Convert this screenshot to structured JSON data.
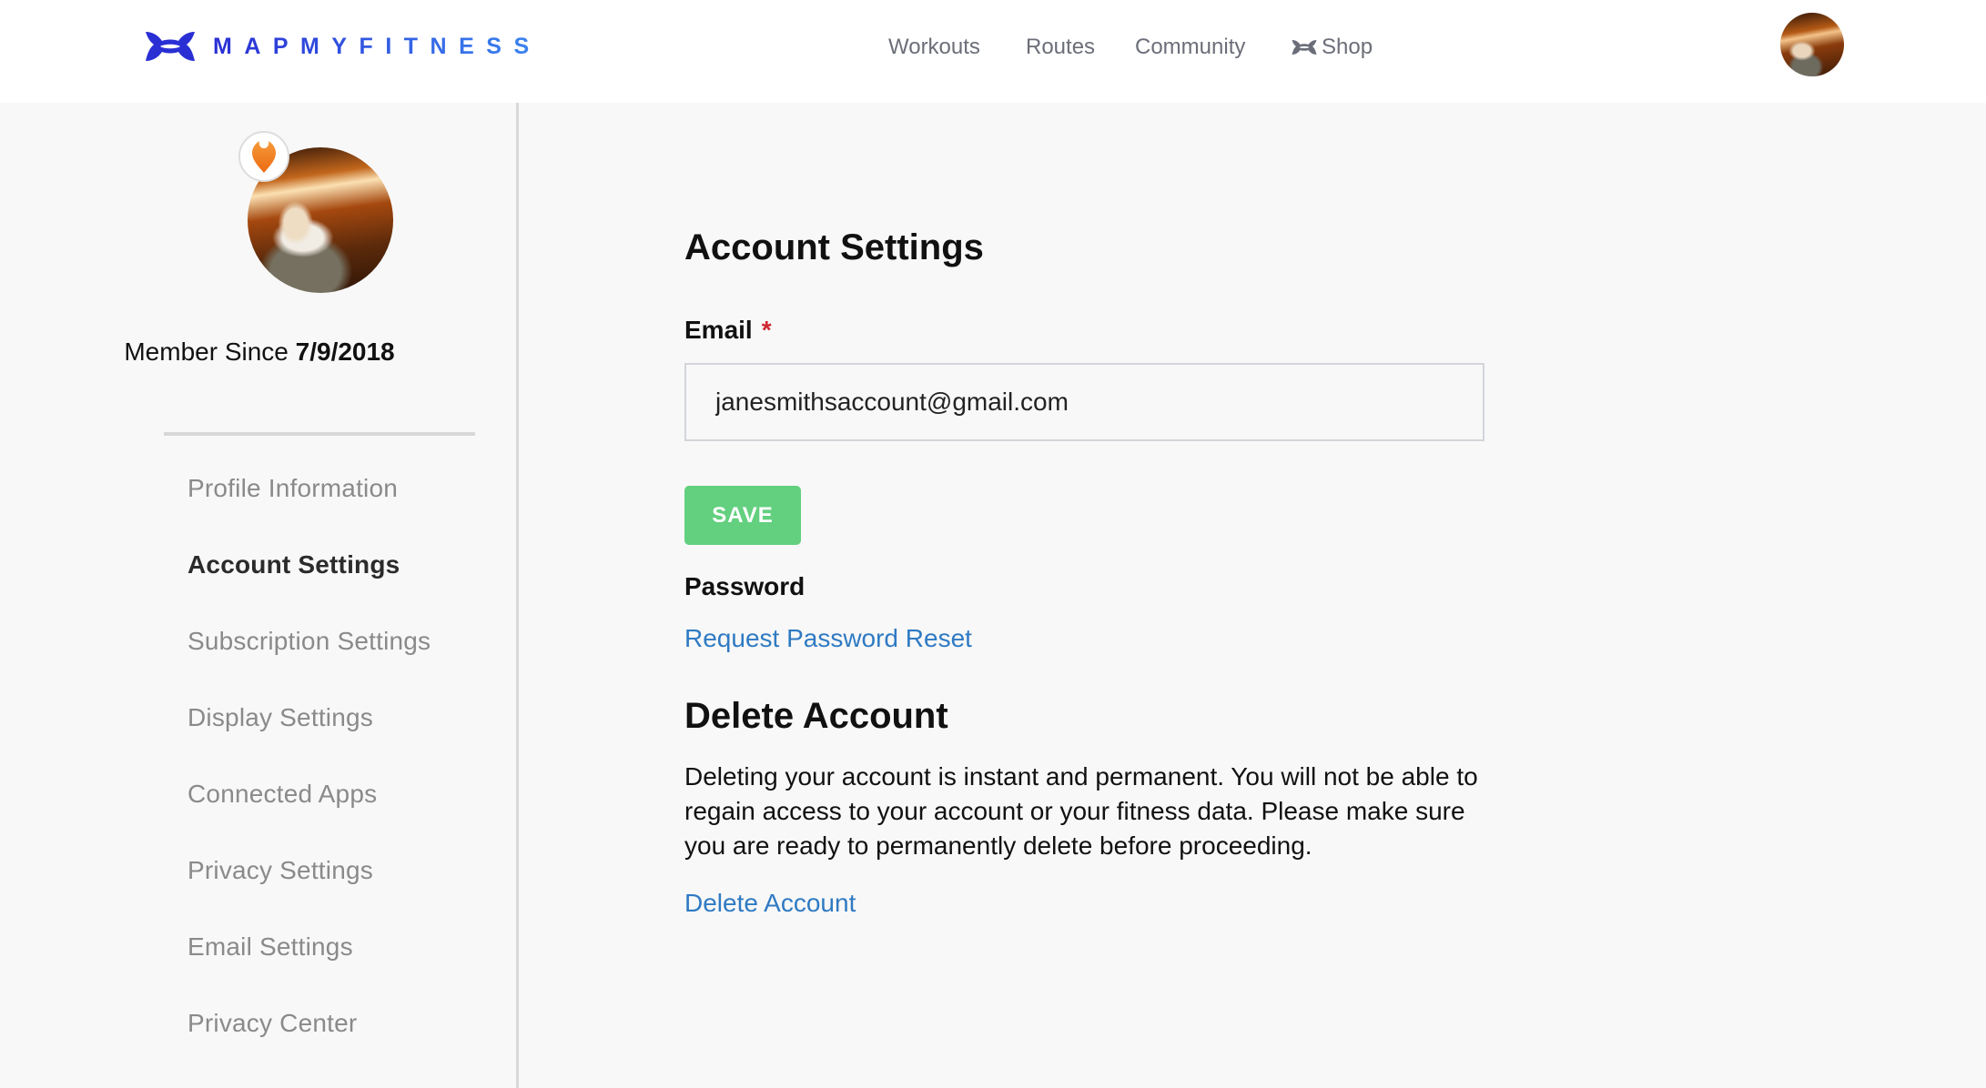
{
  "header": {
    "brand": "MAPMYFITNESS",
    "brand_colors": {
      "start": "#2a2fd4",
      "end": "#3a86f0"
    },
    "nav": [
      {
        "label": "Workouts"
      },
      {
        "label": "Routes"
      },
      {
        "label": "Community"
      },
      {
        "label": "Shop",
        "icon": "under-armour-logo-icon"
      }
    ],
    "user_avatar": "user-avatar-photo"
  },
  "sidebar": {
    "member_since_label": "Member Since",
    "member_since_date": "7/9/2018",
    "badge_icon": "location-pin-icon",
    "items": [
      {
        "label": "Profile Information",
        "active": false
      },
      {
        "label": "Account Settings",
        "active": true
      },
      {
        "label": "Subscription Settings",
        "active": false
      },
      {
        "label": "Display Settings",
        "active": false
      },
      {
        "label": "Connected Apps",
        "active": false
      },
      {
        "label": "Privacy Settings",
        "active": false
      },
      {
        "label": "Email Settings",
        "active": false
      },
      {
        "label": "Privacy Center",
        "active": false
      }
    ]
  },
  "main": {
    "title": "Account Settings",
    "email": {
      "label": "Email",
      "required_mark": "*",
      "value": "janesmithsaccount@gmail.com"
    },
    "save_label": "SAVE",
    "password_label": "Password",
    "password_reset_link": "Request Password Reset",
    "delete": {
      "title": "Delete Account",
      "description": "Deleting your account is instant and permanent. You will not be able to regain access to your account or your fitness data. Please make sure you are ready to permanently delete before proceeding.",
      "link": "Delete Account"
    }
  },
  "colors": {
    "save_button": "#63d07f",
    "link": "#2f7ac3",
    "required": "#d0262e",
    "badge_pin": "#f07a1e"
  }
}
